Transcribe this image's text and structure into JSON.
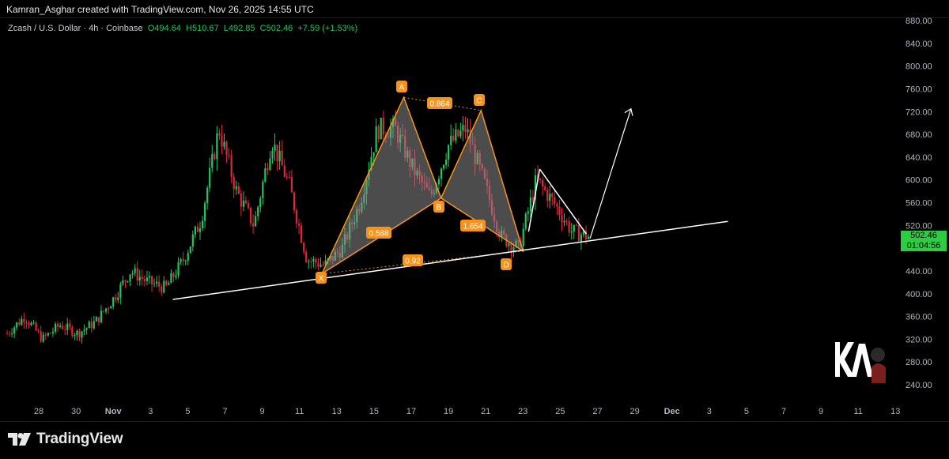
{
  "credit": "Kamran_Asghar created with TradingView.com, Nov 26, 2025 14:55 UTC",
  "legend": {
    "symbol": "Zcash / U.S. Dollar · 4h · Coinbase",
    "open": "O494.64",
    "high": "H510.67",
    "low": "L492.85",
    "close": "C502.46",
    "change": "+7.59 (+1.53%)"
  },
  "price_tag": {
    "price": "502.46",
    "countdown": "01:04:56"
  },
  "branding": {
    "logo_text": "TradingView",
    "watermark": "KAMRAN ASGHAR KA"
  },
  "colors": {
    "up": "#22c55e",
    "down": "#e0243c",
    "pattern": "#f7931a",
    "line": "#ffffff",
    "background": "#000000"
  },
  "chart_data": {
    "type": "candlestick",
    "title": "Zcash / U.S. Dollar · 4h · Coinbase",
    "y_axis": {
      "ticks": [
        "880.00",
        "840.00",
        "800.00",
        "760.00",
        "720.00",
        "680.00",
        "640.00",
        "600.00",
        "560.00",
        "520.00",
        "480.00",
        "440.00",
        "400.00",
        "360.00",
        "320.00",
        "280.00",
        "240.00"
      ],
      "ylim": [
        220,
        890
      ]
    },
    "x_axis": {
      "ticks": [
        "28",
        "30",
        "Nov",
        "3",
        "5",
        "7",
        "9",
        "11",
        "13",
        "15",
        "17",
        "19",
        "21",
        "23",
        "25",
        "27",
        "29",
        "Dec",
        "3",
        "5",
        "7",
        "9",
        "11",
        "13"
      ]
    },
    "price_path": [
      {
        "t": 0,
        "p": 330
      },
      {
        "t": 2,
        "p": 360
      },
      {
        "t": 4,
        "p": 320
      },
      {
        "t": 6,
        "p": 345
      },
      {
        "t": 8,
        "p": 330
      },
      {
        "t": 10,
        "p": 350
      },
      {
        "t": 12,
        "p": 390
      },
      {
        "t": 14,
        "p": 440
      },
      {
        "t": 16,
        "p": 420
      },
      {
        "t": 18,
        "p": 410
      },
      {
        "t": 20,
        "p": 460
      },
      {
        "t": 22,
        "p": 530
      },
      {
        "t": 24,
        "p": 690
      },
      {
        "t": 26,
        "p": 580
      },
      {
        "t": 28,
        "p": 520
      },
      {
        "t": 30,
        "p": 670
      },
      {
        "t": 32,
        "p": 590
      },
      {
        "t": 34,
        "p": 460
      },
      {
        "t": 36,
        "p": 450
      },
      {
        "t": 38,
        "p": 480
      },
      {
        "t": 40,
        "p": 560
      },
      {
        "t": 42,
        "p": 690
      },
      {
        "t": 44,
        "p": 690
      },
      {
        "t": 46,
        "p": 620
      },
      {
        "t": 48,
        "p": 570
      },
      {
        "t": 50,
        "p": 660
      },
      {
        "t": 52,
        "p": 690
      },
      {
        "t": 54,
        "p": 600
      },
      {
        "t": 56,
        "p": 500
      },
      {
        "t": 58,
        "p": 480
      },
      {
        "t": 60,
        "p": 600
      },
      {
        "t": 62,
        "p": 560
      },
      {
        "t": 64,
        "p": 510
      },
      {
        "t": 66,
        "p": 500
      }
    ],
    "harmonic_pattern": {
      "points": [
        {
          "label": "X",
          "x": "Nov 12",
          "y": 435
        },
        {
          "label": "A",
          "x": "Nov 16",
          "y": 745
        },
        {
          "label": "B",
          "x": "Nov 18",
          "y": 568
        },
        {
          "label": "C",
          "x": "Nov 20",
          "y": 722
        },
        {
          "label": "D",
          "x": "Nov 22",
          "y": 475
        }
      ],
      "ratios": [
        "0.588",
        "0.864",
        "1.654",
        "0.92"
      ]
    },
    "trendline": {
      "from": {
        "x": "Nov 4",
        "y": 390
      },
      "to": {
        "x": "Nov 30",
        "y": 527
      }
    },
    "projection_arrow": {
      "from": {
        "x": "Nov 26",
        "y": 497
      },
      "to": {
        "x": "Nov 27",
        "y": 725
      }
    },
    "triangle_line": {
      "from": {
        "x": "Nov 23",
        "y": 619
      },
      "to": {
        "x": "Nov 25",
        "y": 505
      }
    }
  }
}
